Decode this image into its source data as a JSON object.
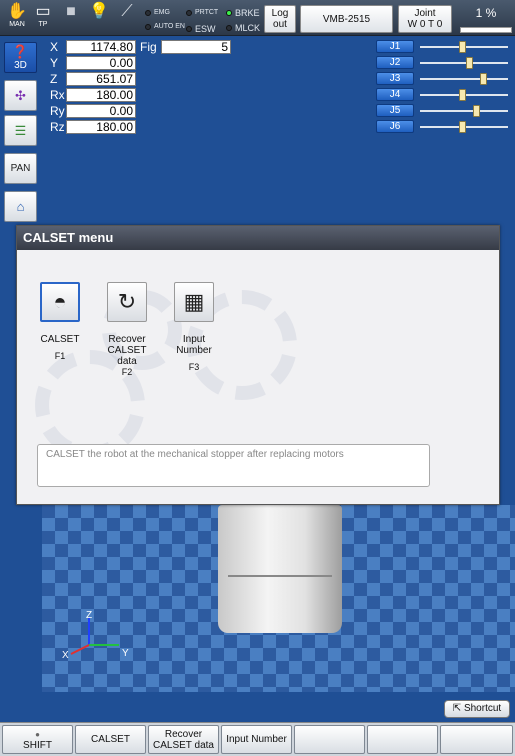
{
  "topbar": {
    "mode_man": "MAN",
    "mode_tp": "TP",
    "lamps": {
      "emg": "EMG",
      "prtct": "PRTCT",
      "brke": "BRKE",
      "auto_en": "AUTO EN",
      "esw": "ESW",
      "mlck": "MLCK"
    },
    "logout": "Log out",
    "robot_model": "VMB-2515",
    "joint_line1": "Joint",
    "joint_line2": "W 0 T 0",
    "speed": "1 %"
  },
  "left_toolbar": {
    "view_3d": "3D",
    "pan": "PAN"
  },
  "coords": {
    "X": "1174.80",
    "Y": "0.00",
    "Z": "651.07",
    "Rx": "180.00",
    "Ry": "0.00",
    "Rz": "180.00",
    "fig_label": "Fig",
    "fig": "5"
  },
  "joints": {
    "labels": [
      "J1",
      "J2",
      "J3",
      "J4",
      "J5",
      "J6"
    ],
    "positions": [
      0.48,
      0.56,
      0.72,
      0.48,
      0.64,
      0.48
    ]
  },
  "dialog": {
    "title": "CALSET menu",
    "options": [
      {
        "label": "CALSET",
        "fkey": "F1"
      },
      {
        "label": "Recover CALSET data",
        "fkey": "F2"
      },
      {
        "label": "Input Number",
        "fkey": "F3"
      }
    ],
    "description": "CALSET the robot at the mechanical stopper after replacing motors"
  },
  "axes": {
    "x": "X",
    "y": "Y",
    "z": "Z"
  },
  "shortcut": "Shortcut",
  "function_keys": {
    "shift": "SHIFT",
    "f1": "CALSET",
    "f2": "Recover CALSET data",
    "f3": "Input Number"
  },
  "colors": {
    "background": "#1f4f95",
    "joint_button": "#2f74d8",
    "active_lamp": "#3cf04a"
  }
}
